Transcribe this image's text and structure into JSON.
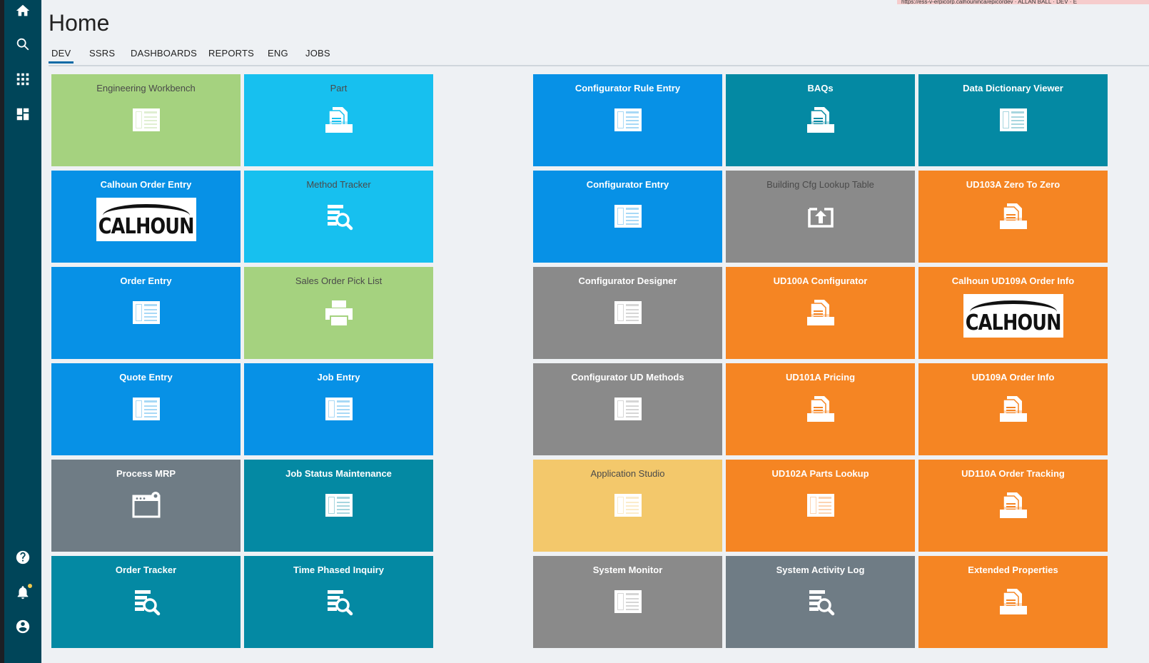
{
  "page": {
    "title": "Home",
    "url_text": "https://ess-v-erpicorp.calhouninca/epicordev · ALLAN BALL · DEV · E"
  },
  "sidebar": {
    "items": [
      {
        "icon": "home-icon"
      },
      {
        "icon": "search-icon"
      },
      {
        "icon": "apps-grid-icon"
      },
      {
        "icon": "dashboard-icon"
      },
      {
        "icon": "help-icon"
      },
      {
        "icon": "notification-bell-icon"
      },
      {
        "icon": "user-account-icon"
      }
    ]
  },
  "tabs": [
    {
      "label": "DEV",
      "active": true
    },
    {
      "label": "SSRS"
    },
    {
      "label": "DASHBOARDS"
    },
    {
      "label": "REPORTS"
    },
    {
      "label": "ENG"
    },
    {
      "label": "JOBS"
    }
  ],
  "colors": {
    "green": "#a5d27f",
    "sky": "#17c0ef",
    "blue": "#0791e6",
    "teal": "#0489a3",
    "gray": "#8a8a8a",
    "slate": "#6f7c85",
    "orange": "#f58523",
    "yellow": "#f3c86b"
  },
  "tiles": [
    {
      "label": "Engineering Workbench",
      "color": "green",
      "icon": "form-icon",
      "dark": true
    },
    {
      "label": "Part",
      "color": "sky",
      "icon": "document-icon",
      "dark": true
    },
    {
      "label": "Configurator Rule Entry",
      "color": "blue",
      "icon": "form-icon"
    },
    {
      "label": "BAQs",
      "color": "teal",
      "icon": "document-icon"
    },
    {
      "label": "Data Dictionary Viewer",
      "color": "teal",
      "icon": "form-icon"
    },
    {
      "label": "Calhoun Order Entry",
      "color": "blue",
      "logo": "CALHOUN"
    },
    {
      "label": "Method Tracker",
      "color": "sky",
      "icon": "search-list-icon",
      "dark": true
    },
    {
      "label": "Configurator Entry",
      "color": "blue",
      "icon": "form-icon"
    },
    {
      "label": "Building Cfg Lookup Table",
      "color": "gray",
      "icon": "upload-box-icon",
      "dark": true
    },
    {
      "label": "UD103A Zero To Zero",
      "color": "orange",
      "icon": "document-icon"
    },
    {
      "label": "Order Entry",
      "color": "blue",
      "icon": "form-icon"
    },
    {
      "label": "Sales Order Pick List",
      "color": "green",
      "icon": "printer-icon",
      "dark": true
    },
    {
      "label": "Configurator Designer",
      "color": "gray",
      "icon": "form-icon"
    },
    {
      "label": "UD100A Configurator",
      "color": "orange",
      "icon": "document-icon"
    },
    {
      "label": "Calhoun UD109A Order Info",
      "color": "orange",
      "logo": "CALHOUN"
    },
    {
      "label": "Quote Entry",
      "color": "blue",
      "icon": "form-icon"
    },
    {
      "label": "Job Entry",
      "color": "blue",
      "icon": "form-icon"
    },
    {
      "label": "Configurator UD Methods",
      "color": "gray",
      "icon": "form-icon"
    },
    {
      "label": "UD101A Pricing",
      "color": "orange",
      "icon": "document-icon"
    },
    {
      "label": "UD109A Order Info",
      "color": "orange",
      "icon": "document-icon"
    },
    {
      "label": "Process MRP",
      "color": "slate",
      "icon": "process-window-icon"
    },
    {
      "label": "Job Status Maintenance",
      "color": "teal",
      "icon": "form-icon"
    },
    {
      "label": "Application Studio",
      "color": "yellow",
      "icon": "form-icon",
      "dark": true
    },
    {
      "label": "UD102A Parts Lookup",
      "color": "orange",
      "icon": "form-icon"
    },
    {
      "label": "UD110A Order Tracking",
      "color": "orange",
      "icon": "document-icon"
    },
    {
      "label": "Order Tracker",
      "color": "teal",
      "icon": "search-list-icon"
    },
    {
      "label": "Time Phased Inquiry",
      "color": "teal",
      "icon": "search-list-icon"
    },
    {
      "label": "System Monitor",
      "color": "gray",
      "icon": "form-icon"
    },
    {
      "label": "System Activity Log",
      "color": "slate",
      "icon": "search-list-icon"
    },
    {
      "label": "Extended Properties",
      "color": "orange",
      "icon": "document-icon"
    }
  ]
}
